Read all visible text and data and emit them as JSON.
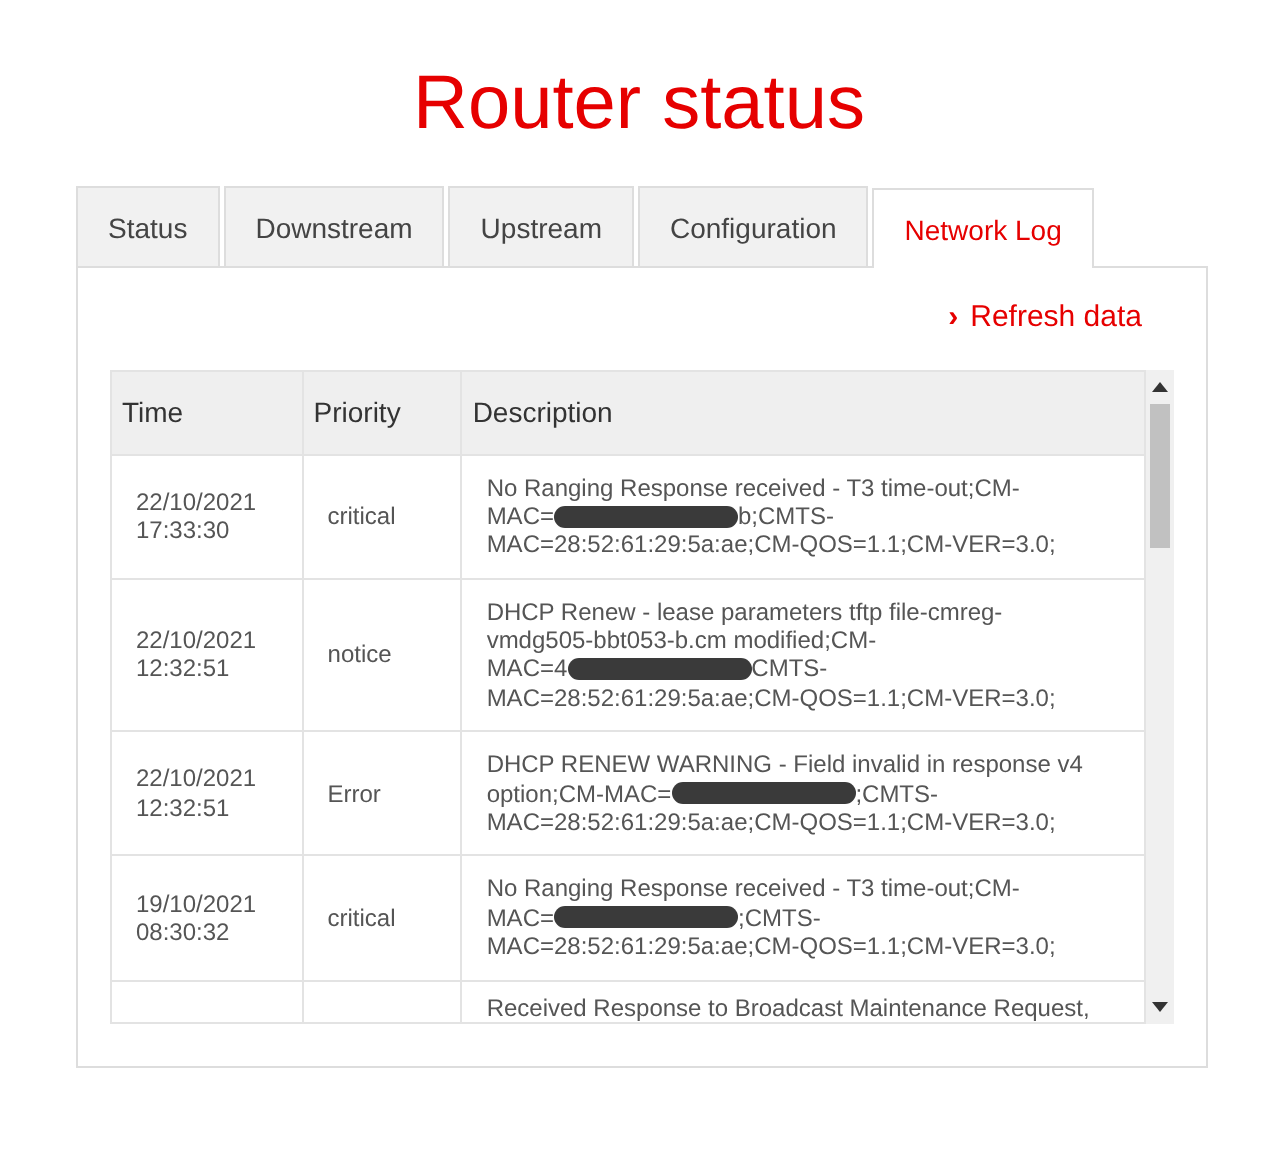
{
  "title": "Router status",
  "tabs": [
    {
      "label": "Status",
      "selected": false
    },
    {
      "label": "Downstream",
      "selected": false
    },
    {
      "label": "Upstream",
      "selected": false
    },
    {
      "label": "Configuration",
      "selected": false
    },
    {
      "label": "Network Log",
      "selected": true
    }
  ],
  "refresh_link": {
    "icon": "›",
    "label": "Refresh data"
  },
  "table": {
    "columns": [
      "Time",
      "Priority",
      "Description"
    ],
    "rows": [
      {
        "time": "22/10/2021 17:33:30",
        "priority": "critical",
        "description_lines": [
          [
            {
              "kind": "text",
              "text": "No Ranging Response received - T3 time-out;CM-"
            }
          ],
          [
            {
              "kind": "text",
              "text": "MAC="
            },
            {
              "kind": "redaction"
            },
            {
              "kind": "text",
              "text": "b;CMTS-"
            }
          ],
          [
            {
              "kind": "text",
              "text": "MAC=28:52:61:29:5a:ae;CM-QOS=1.1;CM-VER=3.0;"
            }
          ]
        ]
      },
      {
        "time": "22/10/2021 12:32:51",
        "priority": "notice",
        "description_lines": [
          [
            {
              "kind": "text",
              "text": "DHCP Renew - lease parameters tftp file-cmreg-"
            }
          ],
          [
            {
              "kind": "text",
              "text": "vmdg505-bbt053-b.cm modified;CM-"
            }
          ],
          [
            {
              "kind": "text",
              "text": "MAC=4"
            },
            {
              "kind": "redaction"
            },
            {
              "kind": "text",
              "text": "CMTS-"
            }
          ],
          [
            {
              "kind": "text",
              "text": "MAC=28:52:61:29:5a:ae;CM-QOS=1.1;CM-VER=3.0;"
            }
          ]
        ]
      },
      {
        "time": "22/10/2021 12:32:51",
        "priority": "Error",
        "description_lines": [
          [
            {
              "kind": "text",
              "text": "DHCP RENEW WARNING - Field invalid in response v4"
            }
          ],
          [
            {
              "kind": "text",
              "text": "option;CM-MAC="
            },
            {
              "kind": "redaction"
            },
            {
              "kind": "text",
              "text": ";CMTS-"
            }
          ],
          [
            {
              "kind": "text",
              "text": "MAC=28:52:61:29:5a:ae;CM-QOS=1.1;CM-VER=3.0;"
            }
          ]
        ]
      },
      {
        "time": "19/10/2021 08:30:32",
        "priority": "critical",
        "description_lines": [
          [
            {
              "kind": "text",
              "text": "No Ranging Response received - T3 time-out;CM-"
            }
          ],
          [
            {
              "kind": "text",
              "text": "MAC="
            },
            {
              "kind": "redaction"
            },
            {
              "kind": "text",
              "text": ";CMTS-"
            }
          ],
          [
            {
              "kind": "text",
              "text": "MAC=28:52:61:29:5a:ae;CM-QOS=1.1;CM-VER=3.0;"
            }
          ]
        ]
      },
      {
        "description_lines": [
          [
            {
              "kind": "text",
              "text": "Received Response to Broadcast Maintenance Request,"
            }
          ]
        ]
      }
    ]
  }
}
